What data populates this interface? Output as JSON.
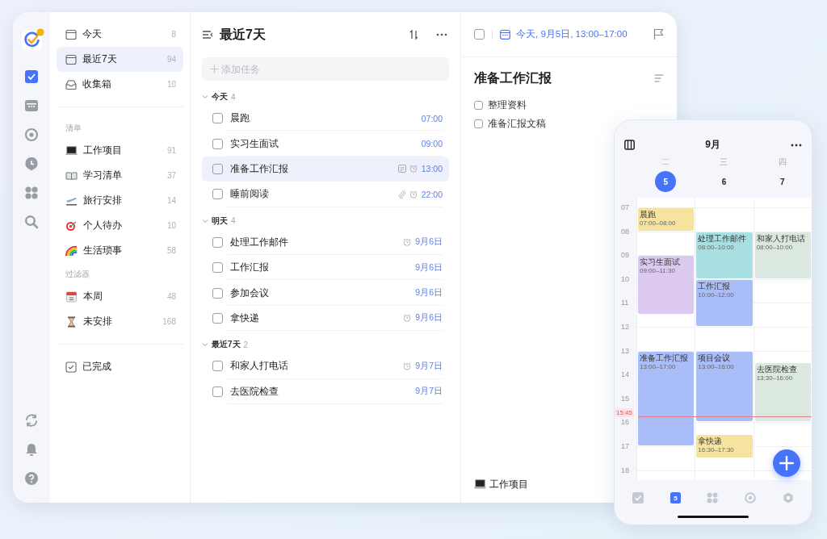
{
  "rail": {
    "tabs": [
      {
        "selected": true
      },
      {
        "selected": false
      },
      {
        "selected": false
      },
      {
        "selected": false
      },
      {
        "selected": false
      },
      {
        "selected": false
      }
    ]
  },
  "sidebar": {
    "smart_lists": [
      {
        "label": "今天",
        "count": "8",
        "selected": false
      },
      {
        "label": "最近7天",
        "count": "94",
        "selected": true
      },
      {
        "label": "收集箱",
        "count": "10",
        "selected": false
      }
    ],
    "sections": [
      {
        "title": "清单",
        "items": [
          {
            "label": "工作项目",
            "count": "91",
            "selected": false
          },
          {
            "label": "学习清单",
            "count": "37",
            "selected": false
          },
          {
            "label": "旅行安排",
            "count": "14",
            "selected": false
          },
          {
            "label": "个人待办",
            "count": "10",
            "selected": false
          },
          {
            "label": "生活琐事",
            "count": "58",
            "selected": false
          }
        ]
      },
      {
        "title": "过滤器",
        "items": [
          {
            "label": "本周",
            "count": "48",
            "selected": false
          },
          {
            "label": "未安排",
            "count": "168",
            "selected": false
          }
        ]
      }
    ],
    "completed": {
      "label": "已完成"
    }
  },
  "task_list": {
    "title": "最近7天",
    "add_task": {
      "placeholder": "添加任务"
    },
    "groups": [
      {
        "title": "今天",
        "count": "4",
        "expanded": true,
        "tasks": [
          {
            "title": "晨跑",
            "checked": false,
            "selected": false,
            "note": false,
            "attachment": false,
            "reminder": false,
            "due": "07:00"
          },
          {
            "title": "实习生面试",
            "checked": false,
            "selected": false,
            "note": false,
            "attachment": false,
            "reminder": false,
            "due": "09:00"
          },
          {
            "title": "准备工作汇报",
            "checked": false,
            "selected": true,
            "note": true,
            "attachment": false,
            "reminder": true,
            "due": "13:00"
          },
          {
            "title": "睡前阅读",
            "checked": false,
            "selected": false,
            "note": false,
            "attachment": true,
            "reminder": true,
            "due": "22:00"
          }
        ]
      },
      {
        "title": "明天",
        "count": "4",
        "expanded": true,
        "tasks": [
          {
            "title": "处理工作邮件",
            "checked": false,
            "selected": false,
            "note": false,
            "attachment": false,
            "reminder": true,
            "due": "9月6日"
          },
          {
            "title": "工作汇报",
            "checked": false,
            "selected": false,
            "note": false,
            "attachment": false,
            "reminder": false,
            "due": "9月6日"
          },
          {
            "title": "参加会议",
            "checked": false,
            "selected": false,
            "note": false,
            "attachment": false,
            "reminder": false,
            "due": "9月6日"
          },
          {
            "title": "拿快递",
            "checked": false,
            "selected": false,
            "note": false,
            "attachment": false,
            "reminder": true,
            "due": "9月6日"
          }
        ]
      },
      {
        "title": "最近7天",
        "count": "2",
        "expanded": true,
        "tasks": [
          {
            "title": "和家人打电话",
            "checked": false,
            "selected": false,
            "note": false,
            "attachment": false,
            "reminder": true,
            "due": "9月7日"
          },
          {
            "title": "去医院检查",
            "checked": false,
            "selected": false,
            "note": false,
            "attachment": false,
            "reminder": false,
            "due": "9月7日"
          }
        ]
      }
    ]
  },
  "detail": {
    "checked": false,
    "date": "今天, 9月5日, 13:00–17:00",
    "title": "准备工作汇报",
    "subtasks": [
      {
        "title": "整理资料",
        "checked": false
      },
      {
        "title": "准备汇报文稿",
        "checked": false
      }
    ],
    "list": "工作项目"
  },
  "phone": {
    "month": "9月",
    "days": [
      {
        "weekday": "二",
        "date": "5",
        "selected": true,
        "events": [
          {
            "title": "晨跑",
            "time": "07:00–08:00",
            "color": "#f7e3a0"
          },
          {
            "title": "实习生面试",
            "time": "09:00–11:30",
            "color": "#dcc9f0"
          },
          {
            "title": "准备工作汇报",
            "time": "13:00–17:00",
            "color": "#a9bdf8"
          }
        ]
      },
      {
        "weekday": "三",
        "date": "6",
        "selected": false,
        "events": [
          {
            "title": "处理工作邮件",
            "time": "08:00–10:00",
            "color": "#a8dfe3"
          },
          {
            "title": "工作汇报",
            "time": "10:00–12:00",
            "color": "#a9bdf8"
          },
          {
            "title": "项目会议",
            "time": "13:00–16:00",
            "color": "#a9bdf8"
          },
          {
            "title": "拿快递",
            "time": "16:30–17:30",
            "color": "#f7e3a0"
          }
        ]
      },
      {
        "weekday": "四",
        "date": "7",
        "selected": false,
        "events": [
          {
            "title": "和家人打电话",
            "time": "08:00–10:00",
            "color": "#dbe8df"
          },
          {
            "title": "去医院检查",
            "time": "13:30–16:00",
            "color": "#dbe8df"
          }
        ]
      }
    ],
    "hours": [
      "07",
      "08",
      "09",
      "10",
      "11",
      "12",
      "13",
      "14",
      "15",
      "16",
      "17",
      "18"
    ],
    "now": "15:45",
    "tabs": [
      {
        "kind": "tasks",
        "selected": false
      },
      {
        "kind": "calendar",
        "label": "5",
        "selected": true
      },
      {
        "kind": "grid",
        "selected": false
      },
      {
        "kind": "focus",
        "selected": false
      },
      {
        "kind": "settings",
        "selected": false
      }
    ]
  }
}
